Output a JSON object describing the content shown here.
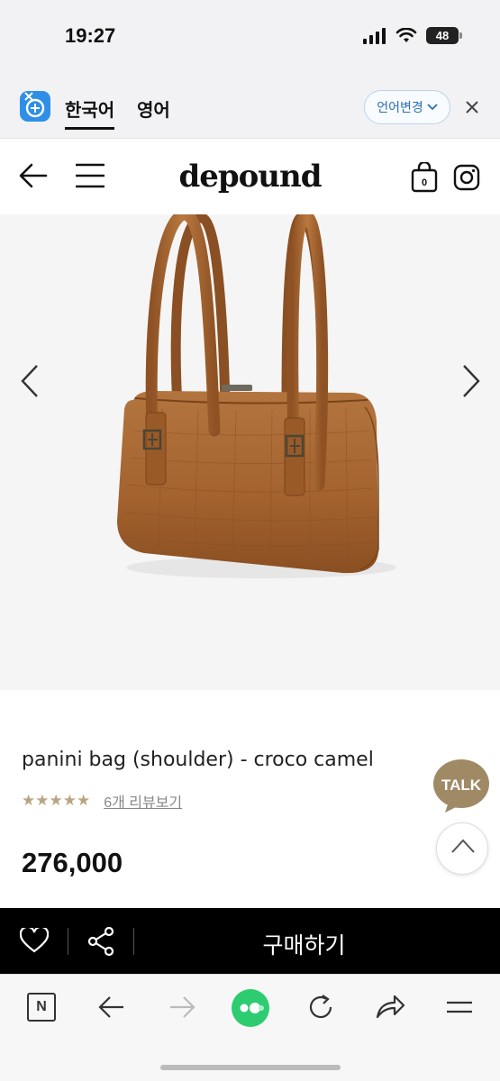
{
  "status": {
    "time": "19:27",
    "battery": "48"
  },
  "translate": {
    "tab_korean": "한국어",
    "tab_english": "영어",
    "change_language": "언어변경"
  },
  "site": {
    "logo": "depound"
  },
  "header": {
    "cart_count": "0"
  },
  "product": {
    "name": "panini bag (shoulder) - croco camel",
    "rating_stars": "★★★★★",
    "rating_value": 5,
    "review_link": "6개 리뷰보기",
    "price": "276,000",
    "bag_color": "#a3622e"
  },
  "chat": {
    "talk_label": "TALK"
  },
  "buy_bar": {
    "buy_label": "구매하기"
  },
  "browser": {
    "n_label": "N"
  },
  "colors": {
    "translate_accent": "#2c6fb7",
    "star_color": "#b9a483",
    "talk_bubble": "#a08a66"
  }
}
